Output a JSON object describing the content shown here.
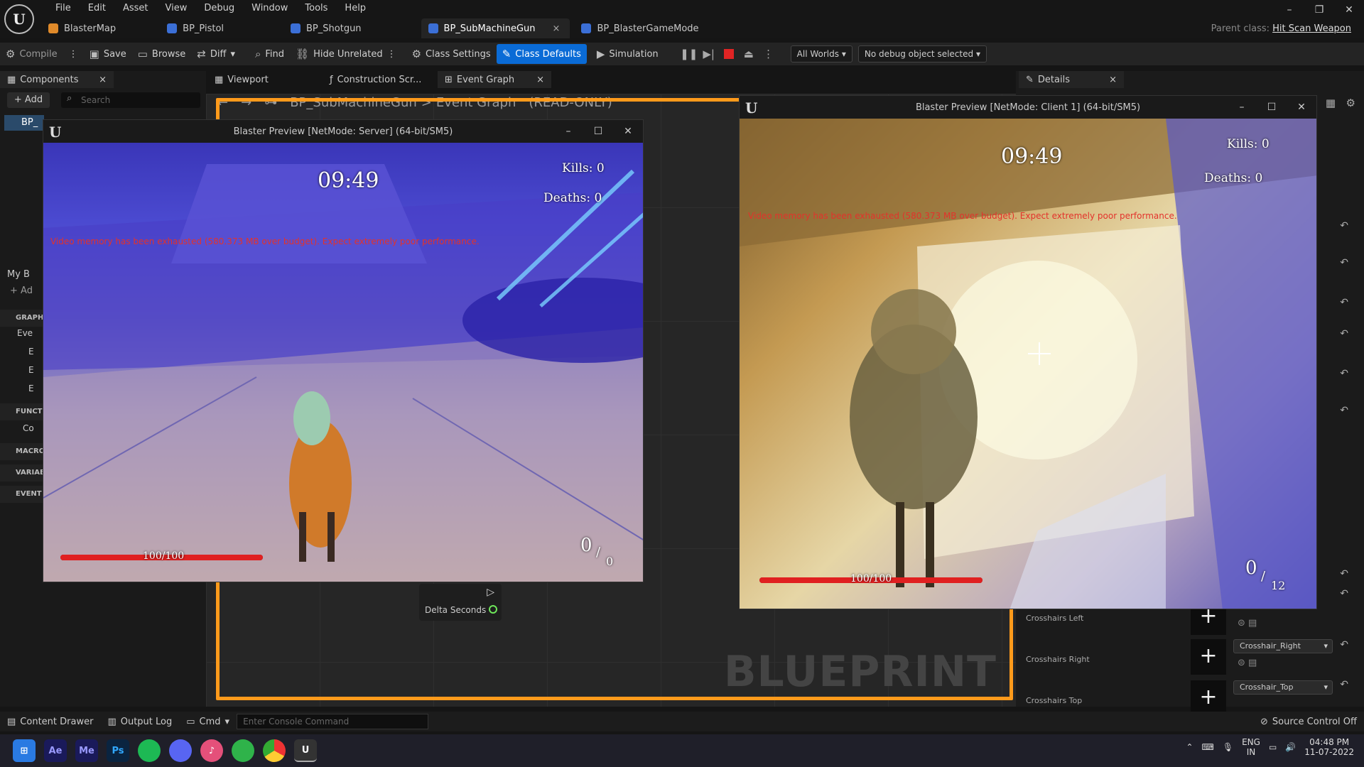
{
  "menu": [
    "File",
    "Edit",
    "Asset",
    "View",
    "Debug",
    "Window",
    "Tools",
    "Help"
  ],
  "asset_tabs": [
    {
      "label": "BlasterMap",
      "color": "#e08a2a"
    },
    {
      "label": "BP_Pistol",
      "color": "#3b6fd6"
    },
    {
      "label": "BP_Shotgun",
      "color": "#3b6fd6"
    },
    {
      "label": "BP_SubMachineGun",
      "color": "#3b6fd6",
      "close": "×"
    },
    {
      "label": "BP_BlasterGameMode",
      "color": "#3b6fd6"
    }
  ],
  "parent_class": {
    "label": "Parent class:",
    "value": "Hit Scan Weapon"
  },
  "toolbar": {
    "compile": "Compile",
    "save": "Save",
    "browse": "Browse",
    "diff": "Diff",
    "find": "Find",
    "hide_unrelated": "Hide Unrelated",
    "class_settings": "Class Settings",
    "class_defaults": "Class Defaults",
    "simulation": "Simulation",
    "worlds": "All Worlds",
    "debug_object": "No debug object selected"
  },
  "left_panel": {
    "components_tab": "Components",
    "add": "+ Add",
    "search_placeholder": "Search",
    "bp_item": "BP_",
    "my_blueprint": "My B",
    "add2": "+ Ad",
    "sections": [
      "GRAPH",
      "FUNCT",
      "MACRO",
      "VARIAB",
      "EVENT"
    ],
    "graph_items": [
      "Eve",
      "E",
      "E",
      "E"
    ],
    "func_item": "Co"
  },
  "graph_tabs": {
    "viewport": "Viewport",
    "construction": "Construction Scr...",
    "event_graph": "Event Graph"
  },
  "breadcrumb": {
    "asset": "BP_SubMachineGun",
    "sep": ">",
    "graph": "Event Graph",
    "mode": "(READ-ONLY)"
  },
  "graph": {
    "delta_seconds": "Delta Seconds",
    "watermark": "BLUEPRINT"
  },
  "details": {
    "tab": "Details",
    "rows": [
      {
        "label": "Crosshairs Left",
        "combo": ""
      },
      {
        "label": "Crosshairs Right",
        "combo": "Crosshair_Right"
      },
      {
        "label": "Crosshairs Top",
        "combo": "Crosshair_Top"
      }
    ]
  },
  "server_window": {
    "title": "Blaster Preview [NetMode: Server]  (64-bit/SM5)",
    "timer": "09:49",
    "kills": "Kills: 0",
    "deaths": "Deaths: 0",
    "warning": "Video memory has been exhausted (580.373 MB over budget). Expect extremely poor performance.",
    "health": "100/100",
    "health_fraction": 1.0,
    "ammo": "0",
    "ammo_sep": "/",
    "carried": "0"
  },
  "client_window": {
    "title": "Blaster Preview [NetMode: Client 1]  (64-bit/SM5)",
    "timer": "09:49",
    "kills": "Kills: 0",
    "deaths": "Deaths: 0",
    "warning": "Video memory has been exhausted (580.373 MB over budget). Expect extremely poor performance.",
    "health": "100/100",
    "health_fraction": 1.0,
    "ammo": "0",
    "ammo_sep": "/",
    "carried": "12"
  },
  "statusbar": {
    "content_drawer": "Content Drawer",
    "output_log": "Output Log",
    "cmd": "Cmd",
    "console_placeholder": "Enter Console Command",
    "source_control": "Source Control Off"
  },
  "taskbar": {
    "apps": [
      {
        "name": "windows-start",
        "label": "",
        "color": "#2a7ae2"
      },
      {
        "name": "after-effects",
        "label": "Ae",
        "color": "#1a1a5a"
      },
      {
        "name": "media-encoder",
        "label": "Me",
        "color": "#1a1a5a"
      },
      {
        "name": "photoshop",
        "label": "Ps",
        "color": "#0a2440"
      },
      {
        "name": "spotify",
        "label": "",
        "color": "#1db954"
      },
      {
        "name": "discord",
        "label": "",
        "color": "#5865f2"
      },
      {
        "name": "itunes",
        "label": "♪",
        "color": "#e4507a"
      },
      {
        "name": "razer",
        "label": "",
        "color": "#2fb34a"
      },
      {
        "name": "chrome",
        "label": "",
        "color": "#e8b52b"
      },
      {
        "name": "unreal",
        "label": "U",
        "color": "#333"
      }
    ],
    "lang": "ENG",
    "region": "IN",
    "time": "04:48 PM",
    "date": "11-07-2022"
  }
}
